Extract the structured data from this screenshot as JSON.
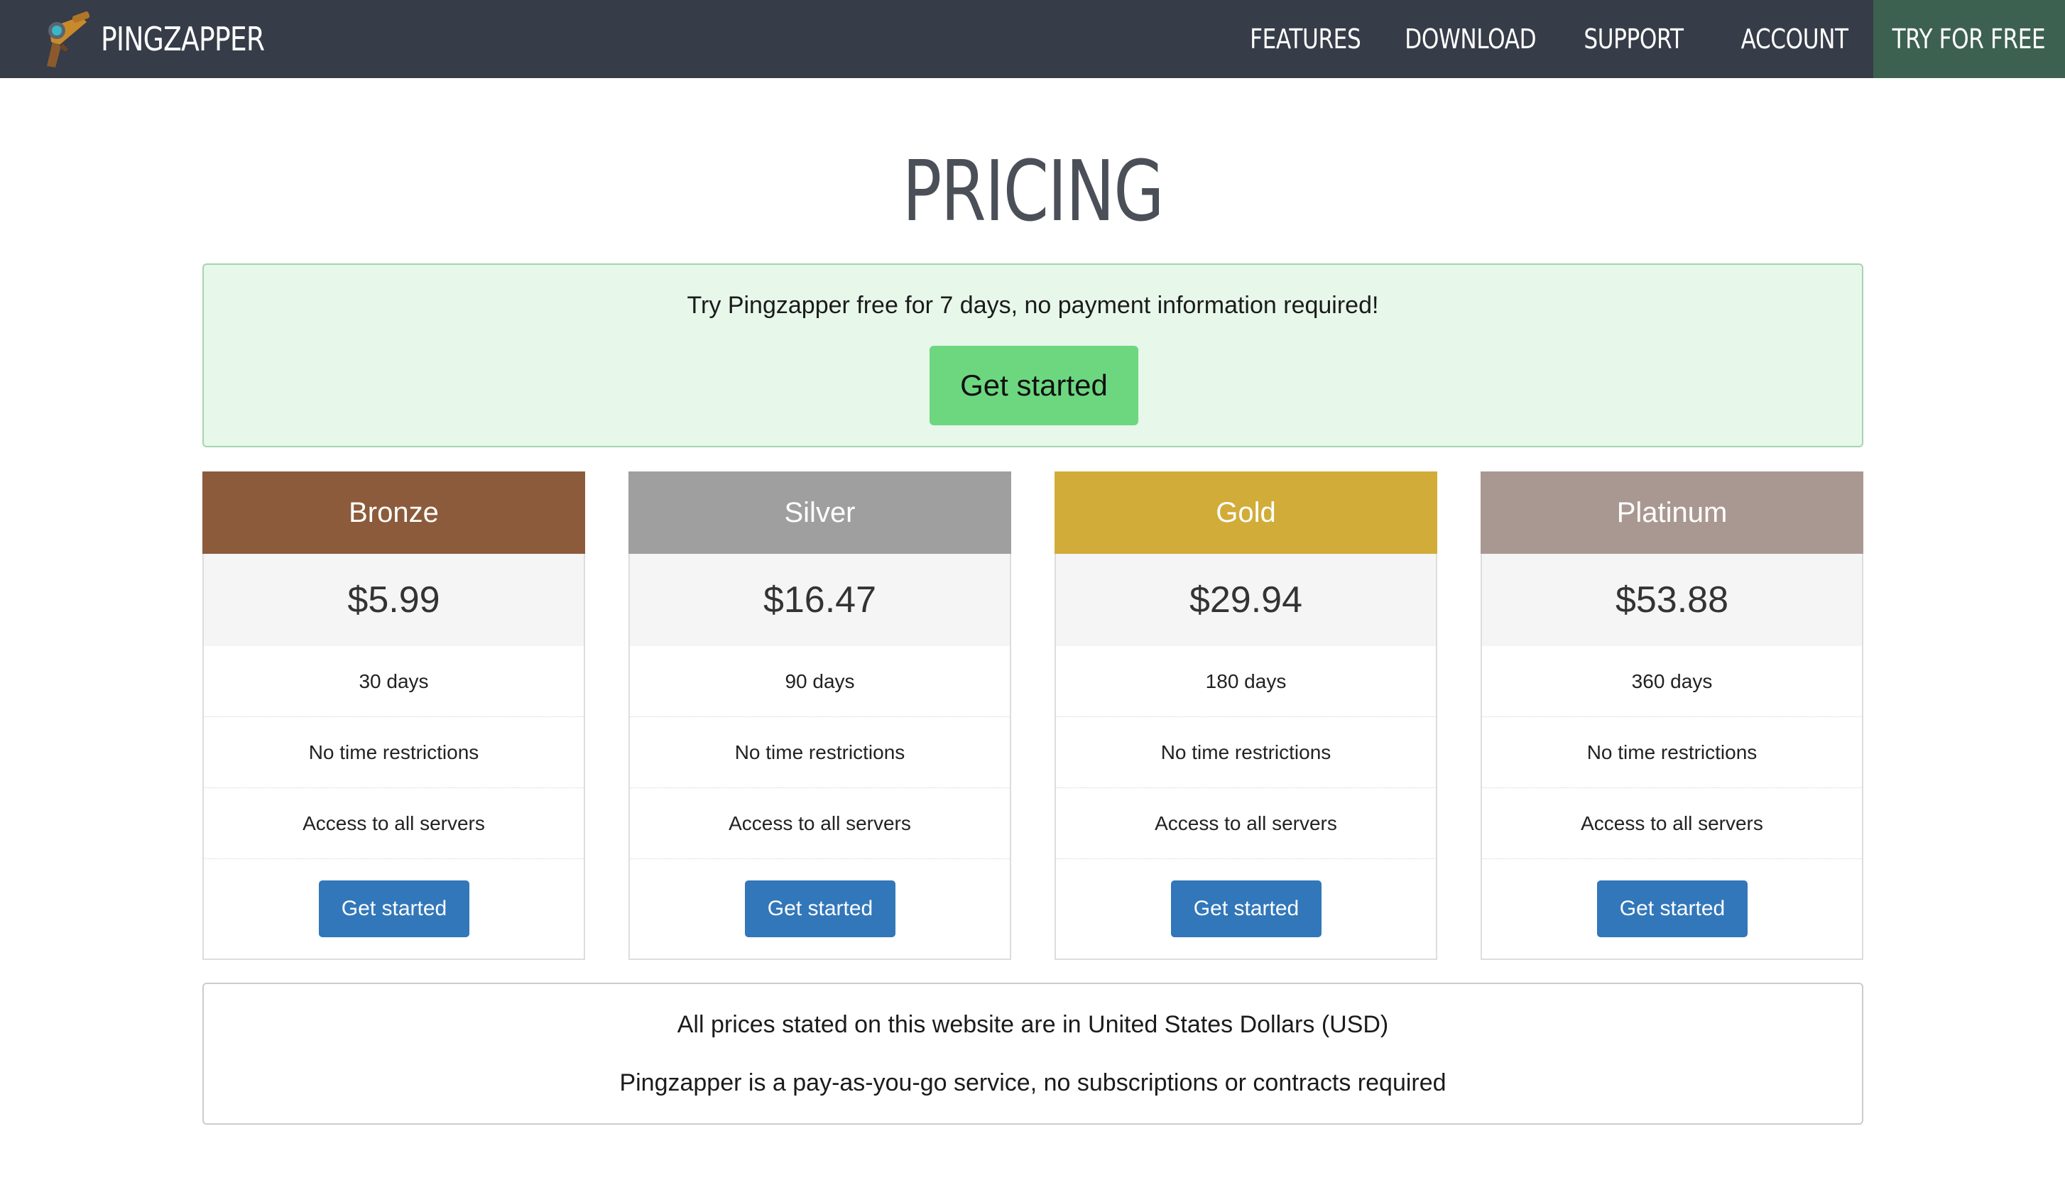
{
  "nav": {
    "brand": "PINGZAPPER",
    "links": [
      "FEATURES",
      "DOWNLOAD",
      "SUPPORT",
      "ACCOUNT"
    ],
    "cta": "TRY FOR FREE",
    "brand_icon": "raygun-icon"
  },
  "page": {
    "title": "PRICING"
  },
  "trial": {
    "text": "Try Pingzapper free for 7 days, no payment information required!",
    "button": "Get started"
  },
  "plans": [
    {
      "name": "Bronze",
      "price": "$5.99",
      "duration": "30 days",
      "feature1": "No time restrictions",
      "feature2": "Access to all servers",
      "button": "Get started",
      "color": "#8b5b3b"
    },
    {
      "name": "Silver",
      "price": "$16.47",
      "duration": "90 days",
      "feature1": "No time restrictions",
      "feature2": "Access to all servers",
      "button": "Get started",
      "color": "#a09f9f"
    },
    {
      "name": "Gold",
      "price": "$29.94",
      "duration": "180 days",
      "feature1": "No time restrictions",
      "feature2": "Access to all servers",
      "button": "Get started",
      "color": "#d2ac38"
    },
    {
      "name": "Platinum",
      "price": "$53.88",
      "duration": "360 days",
      "feature1": "No time restrictions",
      "feature2": "Access to all servers",
      "button": "Get started",
      "color": "#a99891"
    }
  ],
  "notes": {
    "line1": "All prices stated on this website are in United States Dollars (USD)",
    "line2": "Pingzapper is a pay-as-you-go service, no subscriptions or contracts required"
  },
  "colors": {
    "navbar": "#363c48",
    "cta": "#3d6150",
    "trial_bg": "#e7f7ea",
    "trial_button": "#6dd780",
    "plan_button": "#3277b9"
  }
}
